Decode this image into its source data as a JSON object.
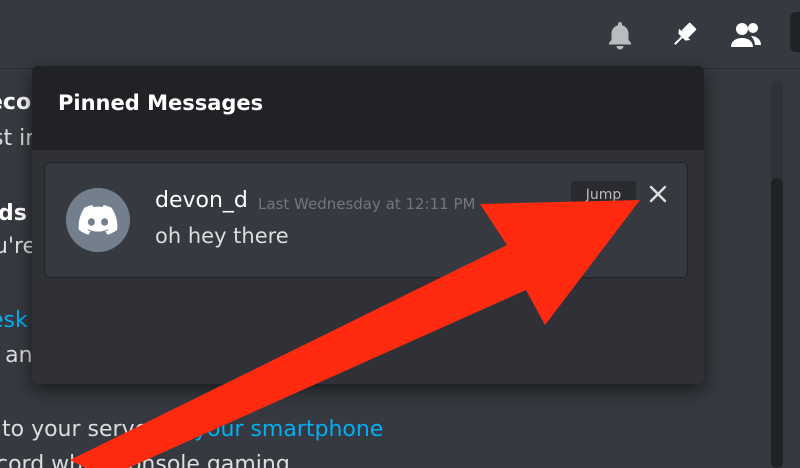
{
  "header": {
    "icons": [
      "bell-icon",
      "pin-icon",
      "members-icon"
    ]
  },
  "background_chat": {
    "lines": [
      "ecor",
      "st in",
      "ds",
      "u're",
      "esk",
      "l anc"
    ],
    "bottom_line_prefix": "to your server fr",
    "bottom_line_link": "your smartphone",
    "partial_line": "cord while console gaming"
  },
  "pinned_popout": {
    "title": "Pinned Messages",
    "message": {
      "author": "devon_d",
      "timestamp": "Last Wednesday at 12:11 PM",
      "text": "oh hey there",
      "jump_label": "Jump"
    }
  },
  "colors": {
    "background": "#36393f",
    "popout_header": "#202225",
    "link": "#00aff4",
    "annotation_arrow": "#ff2a10"
  }
}
